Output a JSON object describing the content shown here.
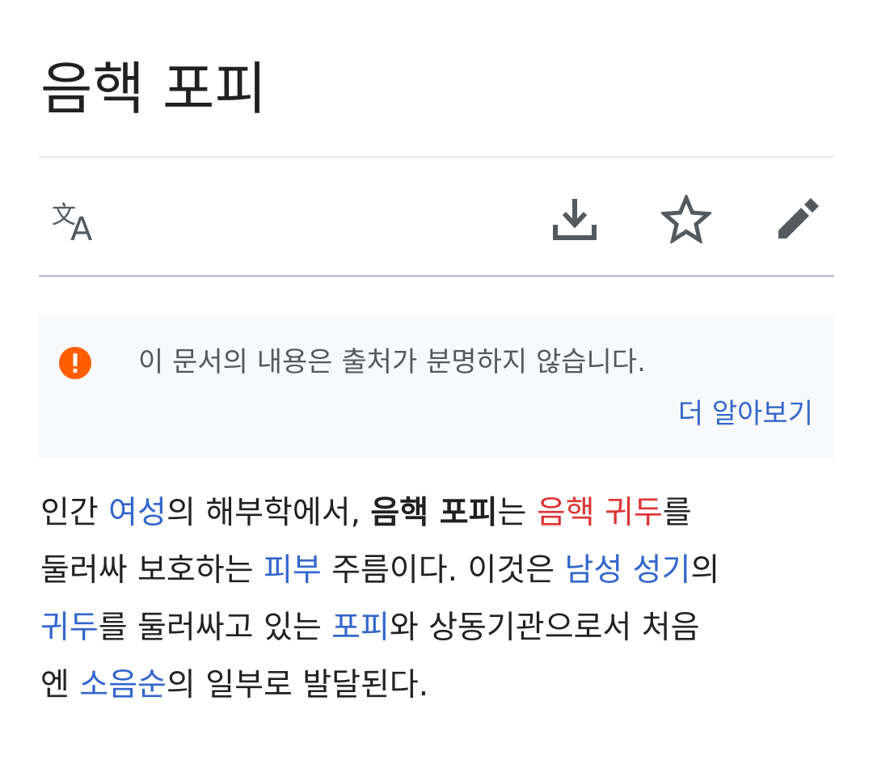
{
  "page": {
    "title": "음핵 포피"
  },
  "toolbar": {
    "language_icon": "translate-icon",
    "download_icon": "download-icon",
    "watch_icon": "star-icon",
    "edit_icon": "pencil-icon"
  },
  "notice": {
    "icon": "exclamation-circle-icon",
    "icon_color": "#ff5d00",
    "text": "이 문서의 내용은 출처가 분명하지 않습니다.",
    "link": "더 알아보기"
  },
  "lead": {
    "line1": {
      "t1": "인간 ",
      "link_woman": "여성",
      "t2": "의 해부학에서, ",
      "bold_term": "음핵 포피",
      "t3": "는 ",
      "redlink": "음핵 귀두",
      "t4": "를"
    },
    "line2": {
      "t1": "둘러싸 보호하는 ",
      "link_skin": "피부",
      "t2": " 주름이다. 이것은 ",
      "link_male_genitalia": "남성 성기",
      "t3": "의"
    },
    "line3": {
      "link_glans": "귀두",
      "t1": "를 둘러싸고 있는 ",
      "link_foreskin": "포피",
      "t2": "와 상동기관으로서 처음"
    },
    "line4": {
      "t1": "엔 ",
      "link_labia": "소음순",
      "t2": "의 일부로 발달된다."
    }
  },
  "colors": {
    "link": "#3366cc",
    "redlink": "#dd3333",
    "text": "#202122",
    "icon": "#54595d",
    "notice_bg": "#f8f9fa"
  }
}
